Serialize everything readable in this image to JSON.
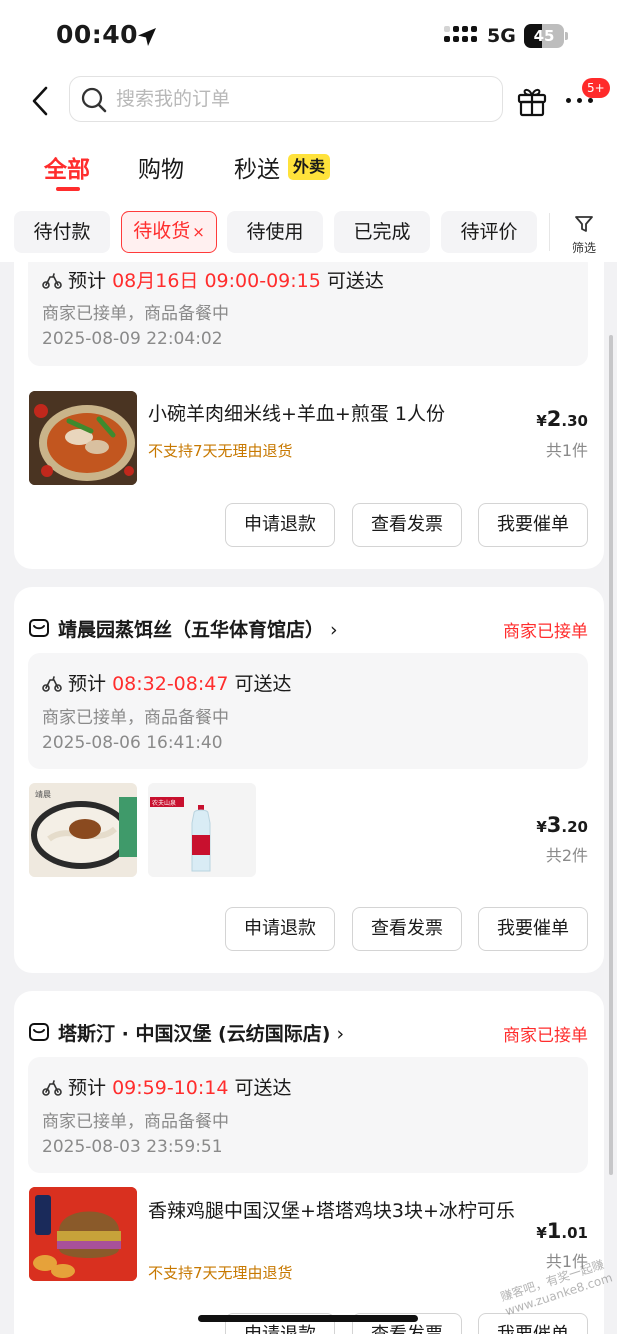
{
  "status_bar": {
    "time": "00:40",
    "network": "5G",
    "battery": "45",
    "battery_level": 0.45
  },
  "header": {
    "search_placeholder": "搜索我的订单",
    "more_badge": "5+"
  },
  "type_tabs": [
    {
      "label": "全部"
    },
    {
      "label": "购物"
    },
    {
      "label": "秒送",
      "badge": "外卖"
    }
  ],
  "filters": [
    {
      "label": "待付款"
    },
    {
      "label": "待收货",
      "close": "×"
    },
    {
      "label": "待使用"
    },
    {
      "label": "已完成"
    },
    {
      "label": "待评价"
    }
  ],
  "filter_button_label": "筛选",
  "orders": [
    {
      "eta_prefix": "预计",
      "eta_time": "08月16日 09:00-09:15",
      "eta_suffix": "可送达",
      "merchant_status": "商家已接单，商品备餐中",
      "timestamp": "2025-08-09 22:04:02",
      "item_title": "小碗羊肉细米线+羊血+煎蛋 1人份",
      "item_note": "不支持7天无理由退货",
      "price_currency": "¥",
      "price_int": "2",
      "price_dec": ".30",
      "count": "共1件",
      "buttons": [
        "申请退款",
        "查看发票",
        "我要催单"
      ]
    },
    {
      "shop_name": "靖晨园蒸饵丝（五华体育馆店）",
      "status": "商家已接单",
      "eta_prefix": "预计",
      "eta_time": "08:32-08:47",
      "eta_suffix": "可送达",
      "merchant_status": "商家已接单，商品备餐中",
      "timestamp": "2025-08-06 16:41:40",
      "thumb1_label": "靖晨",
      "thumb2_label": "农夫山泉",
      "price_currency": "¥",
      "price_int": "3",
      "price_dec": ".20",
      "count": "共2件",
      "buttons": [
        "申请退款",
        "查看发票",
        "我要催单"
      ]
    },
    {
      "shop_name": "塔斯汀 · 中国汉堡 (云纺国际店)",
      "status": "商家已接单",
      "eta_prefix": "预计",
      "eta_time": "09:59-10:14",
      "eta_suffix": "可送达",
      "merchant_status": "商家已接单，商品备餐中",
      "timestamp": "2025-08-03 23:59:51",
      "item_title": "香辣鸡腿中国汉堡+塔塔鸡块3块+冰柠可乐",
      "item_note": "不支持7天无理由退货",
      "price_currency": "¥",
      "price_int": "1",
      "price_dec": ".01",
      "count": "共1件",
      "buttons": [
        "申请退款",
        "查看发票",
        "我要催单"
      ]
    }
  ],
  "watermark": "赚客吧，有奖一起赚 www.zuanke8.com",
  "colors": {
    "accent": "#ff2d2d",
    "note": "#c77800",
    "background": "#f2f2f4"
  }
}
